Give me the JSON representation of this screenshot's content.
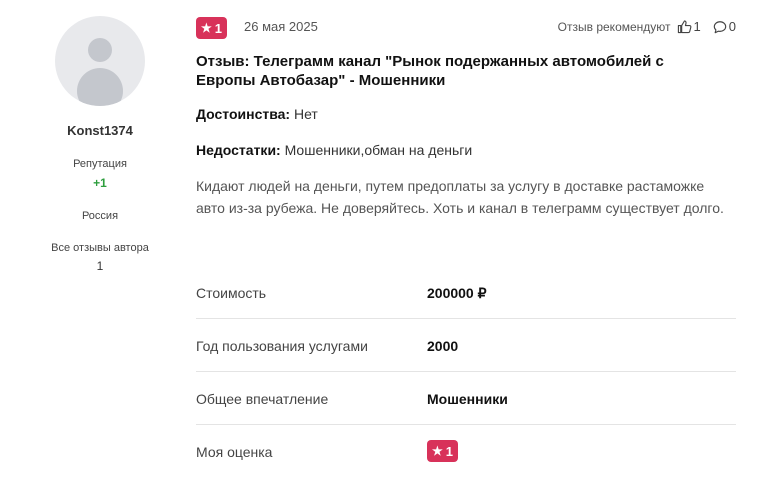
{
  "author": {
    "username": "Konst1374",
    "reputation_label": "Репутация",
    "reputation_value": "+1",
    "country": "Россия",
    "all_reviews_label": "Все отзывы автора",
    "all_reviews_count": "1"
  },
  "review": {
    "rating": "1",
    "date": "26 мая 2025",
    "recommend_label": "Отзыв рекомендуют",
    "likes": "1",
    "comments": "0",
    "title": "Отзыв: Телеграмм канал \"Рынок подержанных автомобилей с Европы Автобазар\" - Мошенники",
    "pros_label": "Достоинства:",
    "pros_value": "Нет",
    "cons_label": "Недостатки:",
    "cons_value": "Мошенники,обман на деньги",
    "text": "Кидают людей на деньги, путем предоплаты за услугу в доставке растаможке авто из-за рубежа. Не доверяйтесь. Хоть и канал в телеграмм существует долго."
  },
  "details": [
    {
      "label": "Стоимость",
      "value": "200000 ₽"
    },
    {
      "label": "Год пользования услугами",
      "value": "2000"
    },
    {
      "label": "Общее впечатление",
      "value": "Мошенники"
    },
    {
      "label": "Моя оценка",
      "value": "1"
    }
  ],
  "colors": {
    "badge": "#d8325a",
    "reputation": "#2e9e3e"
  },
  "icons": {
    "star": "star-icon",
    "like": "thumbs-up-icon",
    "comment": "comment-icon"
  }
}
